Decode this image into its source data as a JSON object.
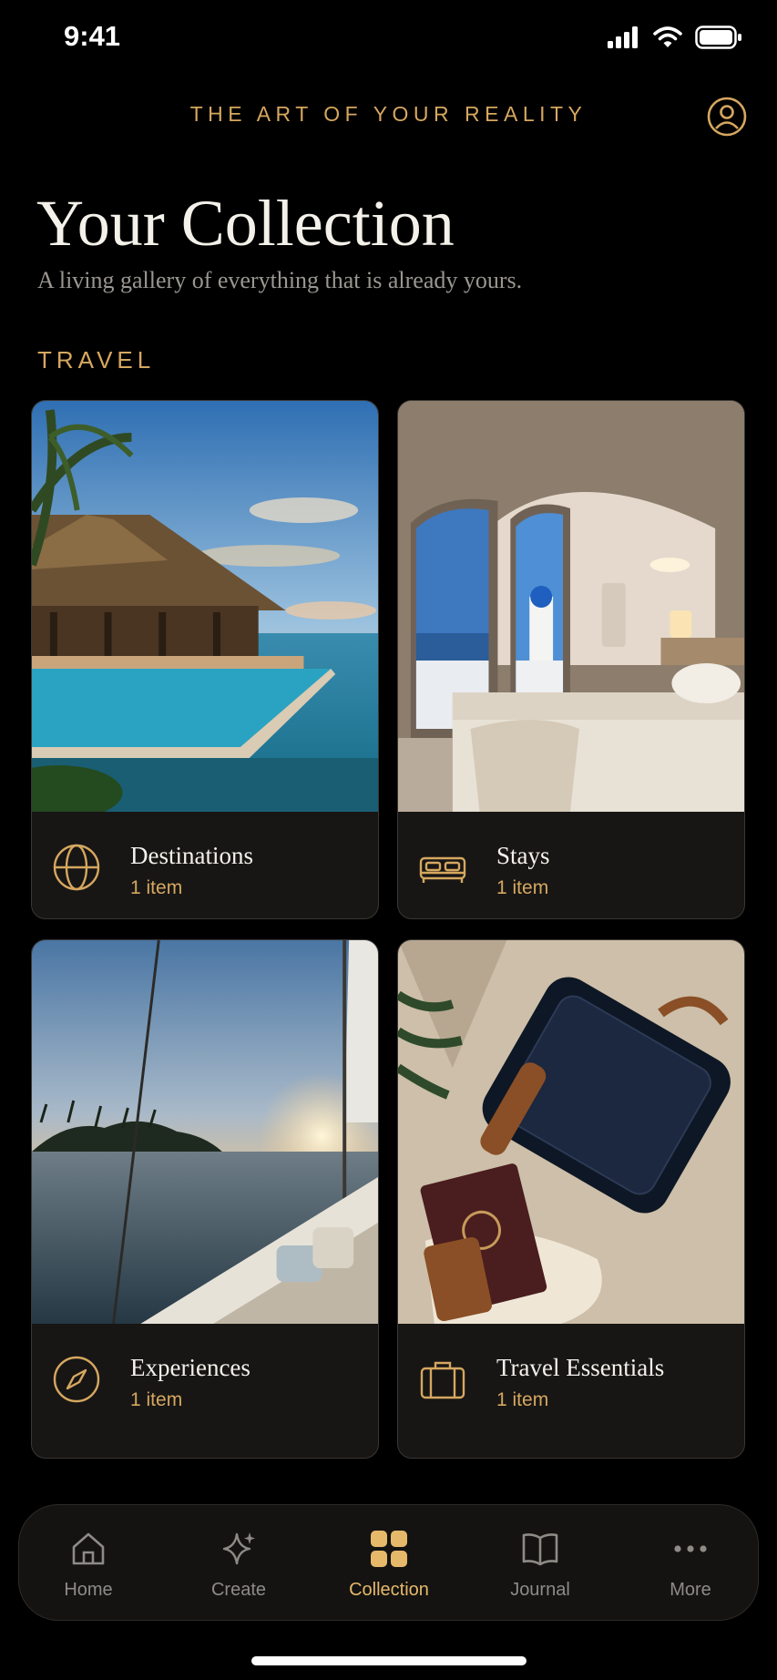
{
  "status": {
    "time": "9:41"
  },
  "header": {
    "brand": "THE ART OF YOUR REALITY"
  },
  "page": {
    "title": "Your Collection",
    "subtitle": "A living gallery of everything that is already yours."
  },
  "section": {
    "label": "TRAVEL"
  },
  "cards": [
    {
      "name": "Destinations",
      "count": "1 item",
      "icon": "globe-icon"
    },
    {
      "name": "Stays",
      "count": "1 item",
      "icon": "bed-icon"
    },
    {
      "name": "Experiences",
      "count": "1 item",
      "icon": "compass-icon"
    },
    {
      "name": "Travel Essentials",
      "count": "1 item",
      "icon": "briefcase-icon"
    }
  ],
  "tabs": [
    {
      "label": "Home",
      "icon": "home-icon"
    },
    {
      "label": "Create",
      "icon": "sparkle-icon"
    },
    {
      "label": "Collection",
      "icon": "grid-icon",
      "active": true
    },
    {
      "label": "Journal",
      "icon": "book-icon"
    },
    {
      "label": "More",
      "icon": "more-icon"
    }
  ],
  "colors": {
    "accent": "#d6a75f",
    "background": "#000000",
    "card": "#171615"
  }
}
